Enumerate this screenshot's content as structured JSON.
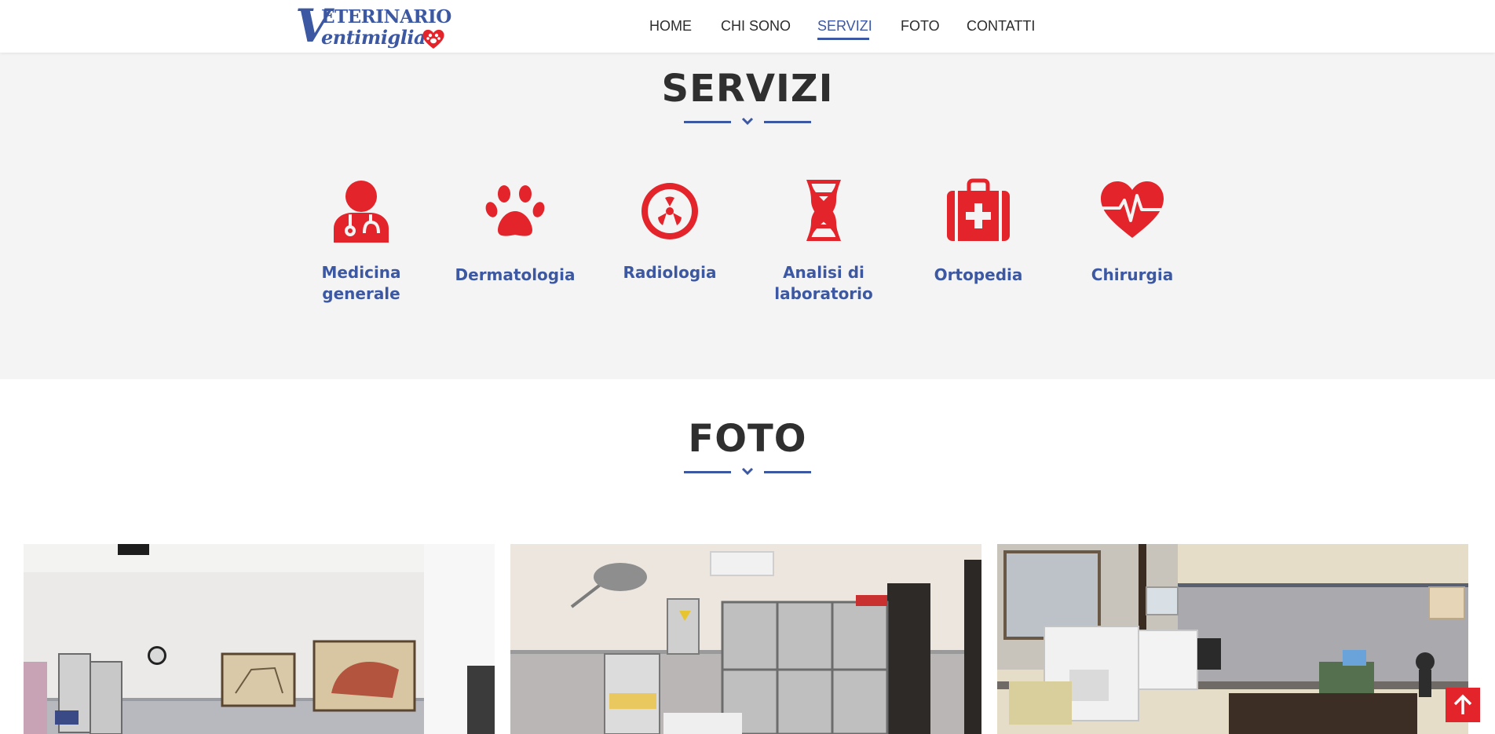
{
  "brand": {
    "line1": "ETERINARIO",
    "line2": "entimiglia",
    "initial": "V",
    "color": "#3d58a3",
    "accent": "#e3242b"
  },
  "nav": {
    "items": [
      {
        "label": "HOME"
      },
      {
        "label": "CHI SONO"
      },
      {
        "label": "SERVIZI",
        "active": true
      },
      {
        "label": "FOTO"
      },
      {
        "label": "CONTATTI"
      }
    ]
  },
  "servizi": {
    "title": "SERVIZI",
    "items": [
      {
        "icon": "doctor-stethoscope-icon",
        "label_lines": [
          "Medicina",
          "generale"
        ]
      },
      {
        "icon": "paw-icon",
        "label_lines": [
          "Dermatologia"
        ]
      },
      {
        "icon": "radiation-icon",
        "label_lines": [
          "Radiologia"
        ]
      },
      {
        "icon": "dna-icon",
        "label_lines": [
          "Analisi di",
          "laboratorio"
        ]
      },
      {
        "icon": "first-aid-kit-icon",
        "label_lines": [
          "Ortopedia"
        ]
      },
      {
        "icon": "heartbeat-icon",
        "label_lines": [
          "Chirurgia"
        ]
      }
    ]
  },
  "foto": {
    "title": "FOTO",
    "photos": [
      {
        "icon": "clinic-waiting-room-photo"
      },
      {
        "icon": "xray-room-photo"
      },
      {
        "icon": "laboratory-photo"
      }
    ]
  },
  "back_to_top": {
    "icon": "arrow-up-icon"
  }
}
